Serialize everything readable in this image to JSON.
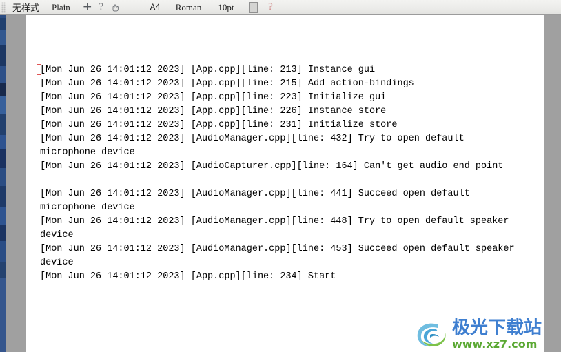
{
  "toolbar": {
    "style_label": "无样式",
    "plain_label": "Plain",
    "insert_icon": "plus-icon",
    "help_icon": "question-mark-icon",
    "hand_icon": "hand-pointer-icon",
    "paper_size": "A4",
    "font_family": "Roman",
    "font_size": "10pt",
    "page_icon": "page-square-icon",
    "help_red_icon": "question-mark-red-icon"
  },
  "document": {
    "cursor": "text-caret",
    "lines": [
      "[Mon Jun 26 14:01:12 2023] [App.cpp][line: 213] Instance gui",
      "[Mon Jun 26 14:01:12 2023] [App.cpp][line: 215] Add action-bindings",
      "[Mon Jun 26 14:01:12 2023] [App.cpp][line: 223] Initialize gui",
      "[Mon Jun 26 14:01:12 2023] [App.cpp][line: 226] Instance store",
      "[Mon Jun 26 14:01:12 2023] [App.cpp][line: 231] Initialize store",
      "[Mon Jun 26 14:01:12 2023] [AudioManager.cpp][line: 432] Try to open default microphone device",
      "[Mon Jun 26 14:01:12 2023] [AudioCapturer.cpp][line: 164] Can't get audio end point",
      "",
      "[Mon Jun 26 14:01:12 2023] [AudioManager.cpp][line: 441] Succeed open default microphone device",
      "[Mon Jun 26 14:01:12 2023] [AudioManager.cpp][line: 448] Try to open default speaker device",
      "[Mon Jun 26 14:01:12 2023] [AudioManager.cpp][line: 453] Succeed open default speaker device",
      "[Mon Jun 26 14:01:12 2023] [App.cpp][line: 234] Start"
    ]
  },
  "watermark": {
    "title": "极光下载站",
    "url": "www.xz7.com",
    "logo_icon": "aurora-swoosh-logo",
    "title_color": "#3f7fd0",
    "url_color": "#5aa832"
  }
}
